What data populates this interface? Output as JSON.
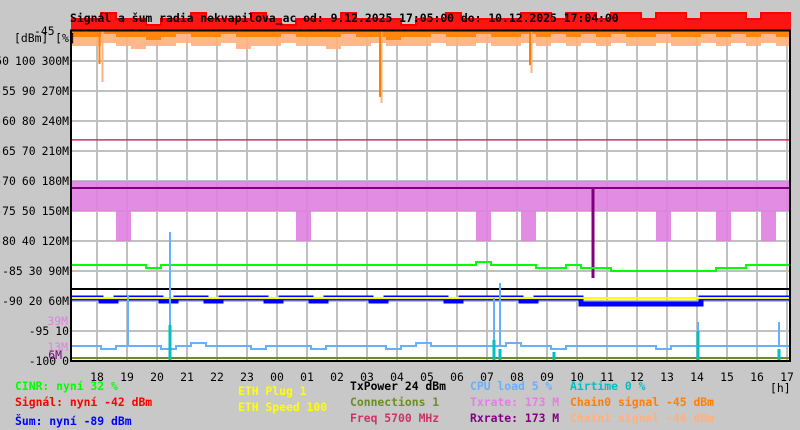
{
  "chart_data": {
    "type": "line",
    "title": "Signál a šum radia nekvapilova_ac od: 9.12.2025 17:05:00 do: 10.12.2025 17:04:00",
    "y_units_label": "[dBm] [%]",
    "y_top_label": "-45",
    "y_axis_dbm": {
      "range": [
        -100,
        -45
      ],
      "ticks": [
        "-50",
        "-55",
        "-60",
        "-65",
        "-70",
        "-75",
        "-80",
        "-85",
        "-90",
        "-95",
        "-100"
      ]
    },
    "y_axis_pct": {
      "range": [
        0,
        110
      ],
      "ticks": [
        "100",
        "90",
        "80",
        "70",
        "60",
        "50",
        "40",
        "30",
        "20",
        "10",
        "0"
      ]
    },
    "y_axis_rate": {
      "range": [
        "0M",
        "330M"
      ],
      "ticks": [
        "300M",
        "270M",
        "240M",
        "210M",
        "180M",
        "150M",
        "120M",
        "90M",
        "60M",
        "",
        ""
      ]
    },
    "rate_markers": [
      {
        "label": "39M",
        "color": "#e080e0"
      },
      {
        "label": "13M",
        "color": "#e080e0"
      },
      {
        "label": "6M",
        "color": "#800080"
      }
    ],
    "x_ticks": [
      "18",
      "19",
      "20",
      "21",
      "22",
      "23",
      "00",
      "01",
      "02",
      "03",
      "04",
      "05",
      "06",
      "07",
      "08",
      "09",
      "10",
      "11",
      "12",
      "13",
      "14",
      "15",
      "16",
      "17"
    ],
    "x_unit": "[h]",
    "x_range_hours": [
      0,
      24
    ],
    "grid": true,
    "series": {
      "signal": {
        "color": "#ff0000",
        "unit": "dBm",
        "values": [
          -43,
          -43,
          -42,
          -43,
          -43,
          -44,
          -43,
          -43,
          -42,
          -43,
          -43,
          -43,
          -42,
          -43,
          -44,
          -43,
          -43,
          -43,
          -42,
          -43,
          -43,
          -43,
          -44,
          -43,
          -43,
          -42,
          -43,
          -43,
          -43,
          -43,
          -42,
          -42,
          -43,
          -42,
          -42,
          -43,
          -42,
          -42,
          -43,
          -42,
          -42,
          -43,
          -42,
          -42,
          -42,
          -43,
          -42,
          -42
        ]
      },
      "chain0": {
        "color": "#ff8000",
        "unit": "dBm",
        "values": [
          -46,
          -46,
          -45.5,
          -46,
          -46,
          -46.5,
          -46,
          -45.5,
          -46,
          -46,
          -45.5,
          -46,
          -46,
          -46,
          -45.5,
          -46,
          -46,
          -46,
          -45.5,
          -46,
          -46,
          -46.5,
          -46,
          -46,
          -45.5,
          -46,
          -46,
          -45.5,
          -46,
          -46,
          -45.5,
          -46,
          -45.5,
          -46,
          -45.5,
          -46,
          -45.5,
          -46,
          -46,
          -45.5,
          -46,
          -46,
          -45.5,
          -46,
          -45.5,
          -46,
          -45.5,
          -46
        ],
        "spikes": [
          {
            "h": 0.95,
            "v": -50.5
          },
          {
            "h": 10.3,
            "v": -56
          },
          {
            "h": 15.3,
            "v": -50.7
          }
        ]
      },
      "chain1": {
        "color": "#ffb080",
        "unit": "dBm",
        "values": [
          -47.5,
          -47.5,
          -47,
          -47.5,
          -48,
          -47.5,
          -47.5,
          -47,
          -47.5,
          -47.5,
          -47,
          -48,
          -47.5,
          -47.5,
          -47,
          -47.5,
          -47.5,
          -48,
          -47.5,
          -47.5,
          -47,
          -47.5,
          -47.5,
          -47.5,
          -47,
          -47.5,
          -47.5,
          -47,
          -47.5,
          -47.5,
          -47,
          -47.5,
          -47,
          -47.5,
          -47,
          -47.5,
          -47,
          -47.5,
          -47.5,
          -47,
          -47.5,
          -47.5,
          -47,
          -47.5,
          -47,
          -47.5,
          -47,
          -47.5
        ],
        "spikes": [
          {
            "h": 1.05,
            "v": -53.5
          },
          {
            "h": 10.35,
            "v": -57
          },
          {
            "h": 15.35,
            "v": -52
          }
        ]
      },
      "noise": {
        "color": "#0000ff",
        "unit": "dBm",
        "values": [
          -89.5,
          -89.5,
          -90,
          -89.5,
          -89.5,
          -89.5,
          -90,
          -89.5,
          -89.5,
          -90,
          -89.5,
          -89.5,
          -89.5,
          -90,
          -89.5,
          -89.5,
          -90,
          -89.5,
          -89.5,
          -89.5,
          -90,
          -89.5,
          -89.5,
          -89.5,
          -89.5,
          -90,
          -89.5,
          -89.5,
          -89.5,
          -89.5,
          -90,
          -89.5,
          -89.5,
          -89.5,
          -90.5,
          -90.5,
          -90.5,
          -90.5,
          -90.5,
          -90.5,
          -90.5,
          -90.5,
          -89.5,
          -89.5,
          -89.5,
          -89.5,
          -89.5,
          -89.5
        ]
      },
      "cinr": {
        "color": "#00ff00",
        "unit": "%",
        "values": [
          32,
          32,
          32,
          32,
          32,
          31,
          32,
          32,
          32,
          32,
          32,
          32,
          32,
          32,
          32,
          32,
          32,
          32,
          32,
          32,
          32,
          32,
          32,
          32,
          32,
          32,
          32,
          33,
          32,
          32,
          32,
          31,
          31,
          32,
          31,
          31,
          30,
          30,
          30,
          30,
          30,
          30,
          30,
          31,
          31,
          32,
          32,
          32
        ]
      },
      "txpower": {
        "color": "#000000",
        "unit": "%",
        "value": 24
      },
      "connections": {
        "color": "#6b8e23",
        "unit": "%",
        "value": 1
      },
      "freq": {
        "color": "#cc3366",
        "unit": "%",
        "value": 73.7
      },
      "eth_speed": {
        "color": "#ffff00",
        "unit": "%",
        "value": 21
      },
      "cpu": {
        "color": "#66b0ff",
        "unit": "%",
        "values": [
          5,
          5,
          4,
          5,
          5,
          5,
          4,
          5,
          6,
          5,
          5,
          5,
          4,
          5,
          5,
          5,
          4,
          5,
          5,
          5,
          5,
          4,
          5,
          6,
          5,
          5,
          5,
          5,
          5,
          6,
          5,
          5,
          4,
          5,
          5,
          5,
          5,
          5,
          5,
          4,
          5,
          5,
          5,
          5,
          5,
          5,
          5,
          5
        ],
        "spikes": [
          {
            "h": 1.9,
            "v": 22
          },
          {
            "h": 3.3,
            "v": 43
          },
          {
            "h": 14.1,
            "v": 21
          },
          {
            "h": 14.3,
            "v": 26
          },
          {
            "h": 20.9,
            "v": 13
          },
          {
            "h": 23.6,
            "v": 13
          }
        ]
      },
      "airtime": {
        "color": "#00c0c0",
        "unit": "%",
        "values": [
          0,
          0,
          0,
          0,
          0,
          0,
          0,
          0,
          0,
          0,
          0,
          0,
          0,
          0,
          0,
          0,
          0,
          0,
          0,
          0,
          0,
          0,
          0,
          0,
          0,
          0,
          0,
          0,
          0,
          0,
          0,
          0,
          0,
          0,
          0,
          0,
          0,
          0,
          0,
          0,
          0,
          0,
          0,
          0,
          0,
          0,
          0,
          0
        ],
        "spikes": [
          {
            "h": 3.3,
            "v": 12
          },
          {
            "h": 14.1,
            "v": 7
          },
          {
            "h": 14.3,
            "v": 4
          },
          {
            "h": 16.1,
            "v": 3
          },
          {
            "h": 20.9,
            "v": 10
          },
          {
            "h": 23.6,
            "v": 4
          }
        ]
      },
      "txrate": {
        "color": "#e080e0",
        "unit": "M",
        "top": 180,
        "values": [
          150,
          150,
          150,
          120,
          150,
          150,
          150,
          150,
          150,
          150,
          150,
          150,
          150,
          150,
          150,
          120,
          150,
          150,
          150,
          150,
          150,
          150,
          150,
          150,
          150,
          150,
          150,
          120,
          150,
          150,
          120,
          150,
          150,
          150,
          150,
          150,
          150,
          150,
          150,
          120,
          150,
          150,
          150,
          120,
          150,
          150,
          120,
          150
        ]
      },
      "rxrate": {
        "color": "#800080",
        "unit": "M",
        "value": 173,
        "spikes": [
          {
            "h": 17.4,
            "v": 83
          }
        ]
      }
    }
  },
  "legend": {
    "cinr": "CINR: nyní 32 %",
    "signal": "Signál: nyní -42 dBm",
    "noise": "Šum: nyní -89 dBm",
    "eth_plug": "ETH Plug 1",
    "eth_speed": "ETH Speed 100",
    "txpower": "TxPower 24 dBm",
    "connections": "Connections 1",
    "freq": "Freq 5700 MHz",
    "cpu": "CPU load 5 %",
    "txrate": "Txrate: 173 M",
    "rxrate": "Rxrate: 173 M",
    "airtime": "Airtime 0 %",
    "chain0": "Chain0 signal -45 dBm",
    "chain1": "Chain1 signal -46 dBm"
  }
}
